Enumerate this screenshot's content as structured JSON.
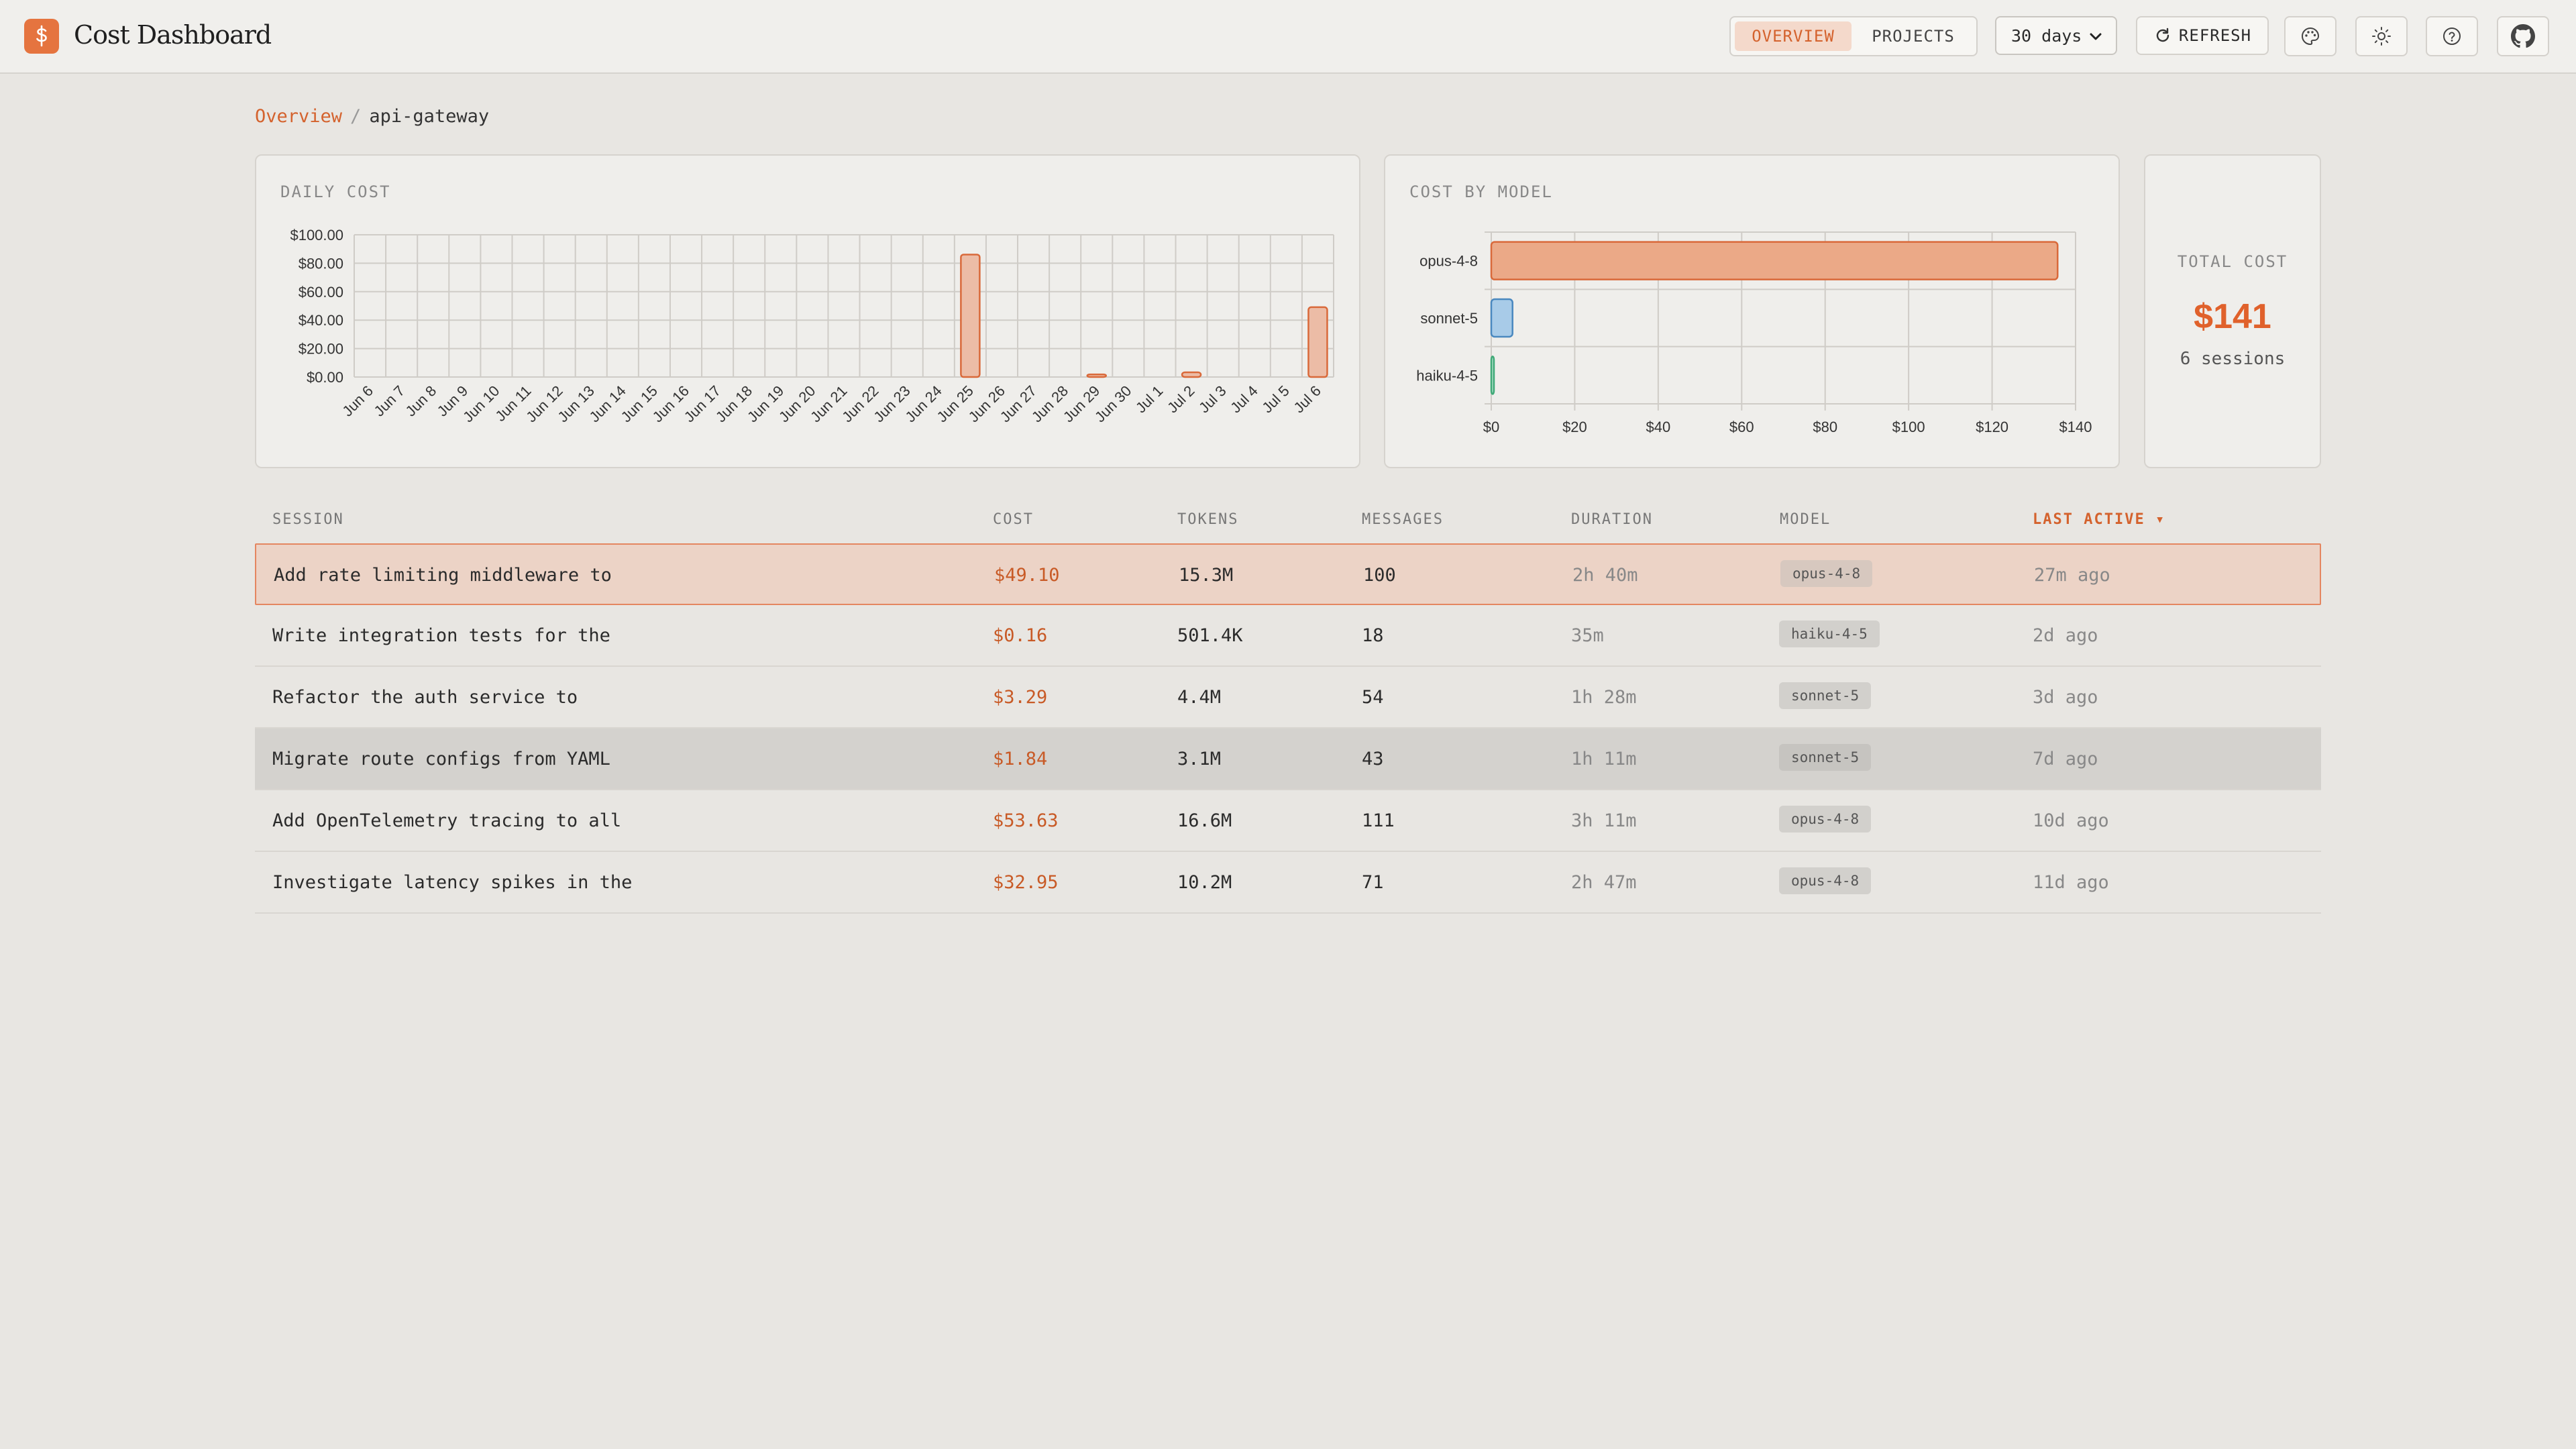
{
  "app": {
    "title": "Cost Dashboard",
    "logo_icon": "dollar-icon",
    "accent": "#e5743f"
  },
  "header": {
    "tabs": [
      {
        "label": "OVERVIEW",
        "active": true
      },
      {
        "label": "PROJECTS",
        "active": false
      }
    ],
    "range": {
      "value": "30 days"
    },
    "refresh_label": "REFRESH",
    "icons": [
      "palette-icon",
      "sun-icon",
      "help-icon",
      "github-icon"
    ]
  },
  "breadcrumb": {
    "root": "Overview",
    "separator": "/",
    "current": "api-gateway"
  },
  "daily_card": {
    "title": "DAILY COST"
  },
  "model_card": {
    "title": "COST BY MODEL"
  },
  "total_card": {
    "label": "TOTAL COST",
    "value": "$141",
    "sessions": "6 sessions"
  },
  "chart_data": [
    {
      "type": "bar",
      "title": "DAILY COST",
      "categories": [
        "Jun 6",
        "Jun 7",
        "Jun 8",
        "Jun 9",
        "Jun 10",
        "Jun 11",
        "Jun 12",
        "Jun 13",
        "Jun 14",
        "Jun 15",
        "Jun 16",
        "Jun 17",
        "Jun 18",
        "Jun 19",
        "Jun 20",
        "Jun 21",
        "Jun 22",
        "Jun 23",
        "Jun 24",
        "Jun 25",
        "Jun 26",
        "Jun 27",
        "Jun 28",
        "Jun 29",
        "Jun 30",
        "Jul 1",
        "Jul 2",
        "Jul 3",
        "Jul 4",
        "Jul 5",
        "Jul 6"
      ],
      "values": [
        0,
        0,
        0,
        0,
        0,
        0,
        0,
        0,
        0,
        0,
        0,
        0,
        0,
        0,
        0,
        0,
        0,
        0,
        0,
        86.1,
        0,
        0,
        0,
        1.84,
        0,
        0,
        3.29,
        0,
        0,
        0,
        49.1
      ],
      "yticks": [
        "$0.00",
        "$20.00",
        "$40.00",
        "$60.00",
        "$80.00",
        "$100.00"
      ],
      "ylim": [
        0,
        100
      ],
      "grid": true,
      "colors": {
        "fill": "#ecbca6",
        "stroke": "#d9693a"
      }
    },
    {
      "type": "bar",
      "orientation": "horizontal",
      "title": "COST BY MODEL",
      "categories": [
        "opus-4-8",
        "sonnet-5",
        "haiku-4-5"
      ],
      "values": [
        135.7,
        5.1,
        0.2
      ],
      "xticks": [
        "$0",
        "$20",
        "$40",
        "$60",
        "$80",
        "$100",
        "$120",
        "$140"
      ],
      "xlim": [
        0,
        140
      ],
      "grid": true,
      "colors": [
        {
          "fill": "#eba987",
          "stroke": "#d9693a"
        },
        {
          "fill": "#a8cbe8",
          "stroke": "#4a88bf"
        },
        {
          "fill": "#a9dcc4",
          "stroke": "#3fa977"
        }
      ]
    }
  ],
  "table": {
    "headers": {
      "session": "SESSION",
      "cost": "COST",
      "tokens": "TOKENS",
      "messages": "MESSAGES",
      "duration": "DURATION",
      "model": "MODEL",
      "last_active": "LAST ACTIVE ▾"
    },
    "sorted_by": "last_active",
    "rows": [
      {
        "session": "Add rate limiting middleware to",
        "cost": "$49.10",
        "tokens": "15.3M",
        "messages": "100",
        "duration": "2h 40m",
        "model": "opus-4-8",
        "last_active": "27m ago",
        "state": "selected"
      },
      {
        "session": "Write integration tests for the",
        "cost": "$0.16",
        "tokens": "501.4K",
        "messages": "18",
        "duration": "35m",
        "model": "haiku-4-5",
        "last_active": "2d ago",
        "state": ""
      },
      {
        "session": "Refactor the auth service to",
        "cost": "$3.29",
        "tokens": "4.4M",
        "messages": "54",
        "duration": "1h 28m",
        "model": "sonnet-5",
        "last_active": "3d ago",
        "state": ""
      },
      {
        "session": "Migrate route configs from YAML",
        "cost": "$1.84",
        "tokens": "3.1M",
        "messages": "43",
        "duration": "1h 11m",
        "model": "sonnet-5",
        "last_active": "7d ago",
        "state": "hovered"
      },
      {
        "session": "Add OpenTelemetry tracing to all",
        "cost": "$53.63",
        "tokens": "16.6M",
        "messages": "111",
        "duration": "3h 11m",
        "model": "opus-4-8",
        "last_active": "10d ago",
        "state": ""
      },
      {
        "session": "Investigate latency spikes in the",
        "cost": "$32.95",
        "tokens": "10.2M",
        "messages": "71",
        "duration": "2h 47m",
        "model": "opus-4-8",
        "last_active": "11d ago",
        "state": ""
      }
    ]
  }
}
